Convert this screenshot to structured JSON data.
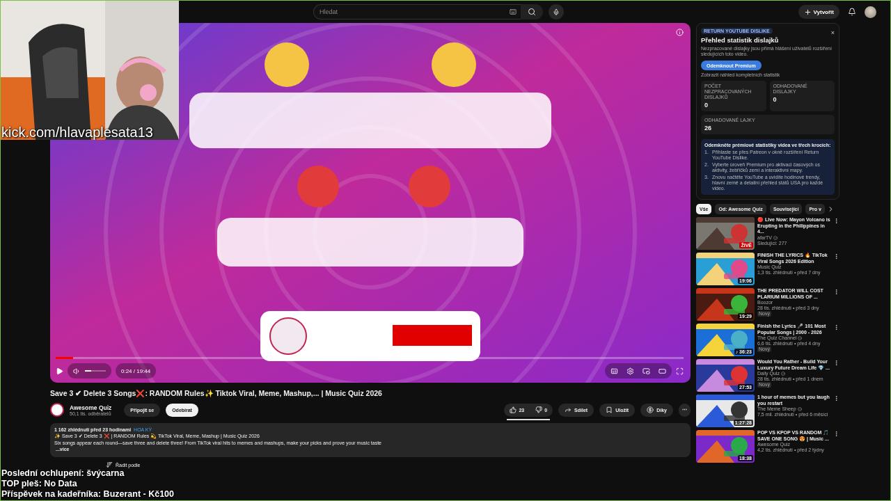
{
  "topbar": {
    "search": {
      "placeholder": "Hledat"
    },
    "create_label": "Vytvořit"
  },
  "webcam": {
    "caption": "kick.com/hlavaplesata13"
  },
  "player": {
    "progress": {
      "level": 0.028
    },
    "volume": {
      "level": 0.3
    },
    "time": "0:24 / 19:44"
  },
  "video": {
    "title": "Save 3 ✔ Delete 3 Songs❌: RANDOM Rules✨ Tiktok Viral, Meme, Mashup,... | Music Quiz 2026",
    "channel": "Awesome Quiz",
    "subscribers": "50,1 tis. odběratelů",
    "join_label": "Připojit se",
    "subscribe_label": "Odebírat",
    "likes": "23",
    "dislikes": "0",
    "ratio": {
      "level": 1
    },
    "share": "Sdílet",
    "save": "Uložit",
    "thanks": "Díky",
    "more": "⋯"
  },
  "description": {
    "views": "1 162 zhlédnutí  před 23 hodinami",
    "tag": "HOA KỲ",
    "line": "✨ Save 3 ✔ Delete 3 ❌ | RANDOM Rules 💫 TikTok Viral, Meme, Mashup | Music Quiz 2026",
    "text": "Six songs appear each round—save three and delete three! From TikTok viral hits to memes and mashups, make your picks and prove your music taste",
    "more": "...více"
  },
  "comments": {
    "sort_label": "Řadit podle"
  },
  "overlay_lines": [
    "Poslední ochlupení: švýcarna",
    "TOP pleš: No Data",
    "Příspěvek na kadeřníka: Buzerant - Kč100"
  ],
  "ryd": {
    "tag": "RETURN YOUTUBE DISLIKE",
    "close": "×",
    "title": "Přehled statistik dislajků",
    "desc": "Nezpracované dislajky jsou přímá hlášení uživatelů rozšíření sledujících toto video.",
    "button": "Odemknout Premium",
    "preview": "Zobrazit náhled kompletních statistik",
    "stats": [
      {
        "label": "POČET NEZPRACOVANÝCH DISLAJKŮ",
        "value": "0"
      },
      {
        "label": "ODHADOVANÉ DISLAJKY",
        "value": "0"
      },
      {
        "label": "ODHADOVANÉ LAJKY",
        "value": "26"
      }
    ],
    "steps_title": "Odemkněte prémiové statistiky videa ve třech krocích:",
    "steps": [
      {
        "num": "1.",
        "text": "Přihlaste se přes Patreon v okně rozšíření Return YouTube Dislike."
      },
      {
        "num": "2.",
        "text": "Vyberte úroveň Premium pro aktivaci časových os aktivity, žebříčků zemí a interaktivní mapy."
      },
      {
        "num": "3.",
        "text": "Znovu načtěte YouTube a uvidíte hodinové trendy, hlavní země a detailní přehled států USA pro každé video."
      }
    ]
  },
  "chips": [
    {
      "label": "Vše",
      "selected": true
    },
    {
      "label": "Od: Awesome Quiz",
      "selected": false
    },
    {
      "label": "Související",
      "selected": false
    },
    {
      "label": "Pro v",
      "selected": false
    }
  ],
  "recommendations": [
    {
      "title": "🔴 Live Now: Mayon Volcano is Erupting in the Philippines in 4...",
      "channel": "afarTV",
      "verified": true,
      "meta": "Sledující: 277",
      "badge": "ŽIVĚ"
    },
    {
      "title": "FINISH THE LYRICS 🔥 TikTok Viral Songs 2026 Edition",
      "channel": "Music Quiz",
      "verified": false,
      "meta": "1,3 tis. zhlédnutí • před 7 dny",
      "duration": "19:06"
    },
    {
      "title": "THE PREDATOR WILL COST PLARIUM MILLIONS OF ...",
      "channel": "Boozor",
      "verified": false,
      "meta": "28 tis. zhlédnutí • před 3 dny",
      "duration": "19:29",
      "new": "Nový"
    },
    {
      "title": "Finish the Lyrics 🎤 101 Most Popular Songs | 2000 - 2026",
      "channel": "The Quiz Channel",
      "verified": true,
      "meta": "6,6 tis. zhlédnutí • před 4 dny",
      "duration": "♪ 36:23",
      "new": "Nový"
    },
    {
      "title": "Would You Rather - Build Your Luxury Future Dream Life 💎 ...",
      "channel": "Daily Quiz",
      "verified": true,
      "meta": "28 tis. zhlédnutí • před 1 dnem",
      "duration": "27:53",
      "new": "Nový"
    },
    {
      "title": "1 hour of memes but you laugh you restart",
      "channel": "The Meme Sheep",
      "verified": true,
      "meta": "7,5 mil. zhlédnutí • před 6 měsíci",
      "duration": "1:27:28"
    },
    {
      "title": "POP VS KPOP VS RANDOM 🎵 SAVE ONE SONG 😍 | Music ...",
      "channel": "Awesome Quiz",
      "verified": false,
      "meta": "4,2 tis. zhlédnutí • před 2 týdny",
      "duration": "18:38"
    }
  ]
}
